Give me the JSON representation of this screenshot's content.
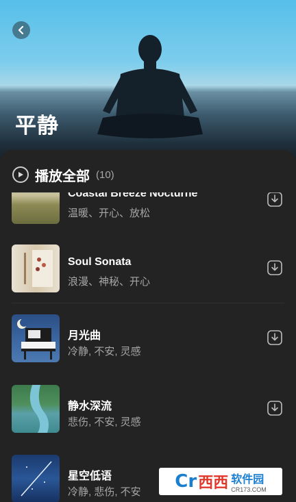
{
  "hero": {
    "title": "平静"
  },
  "header": {
    "play_all_label": "播放全部",
    "count": "(10)"
  },
  "tracks": [
    {
      "title": "Coastal Breeze Nocturne",
      "tags": "温暖、开心、放松"
    },
    {
      "title": "Soul Sonata",
      "tags": "浪漫、神秘、开心"
    },
    {
      "title": "月光曲",
      "tags": "冷静, 不安, 灵感"
    },
    {
      "title": "静水深流",
      "tags": "悲伤, 不安, 灵感"
    },
    {
      "title": "星空低语",
      "tags": "冷静, 悲伤, 不安"
    }
  ],
  "watermark": {
    "brand": "Cr",
    "logo_text": "西西",
    "name": "软件园",
    "url": "CR173.COM"
  },
  "colors": {
    "background": "#232323",
    "sky": "#56bfe9",
    "text_primary": "#ffffff",
    "text_secondary": "#a6a6a6"
  },
  "icons": {
    "back": "chevron-left-icon",
    "play": "play-circle-icon",
    "download": "download-icon"
  }
}
